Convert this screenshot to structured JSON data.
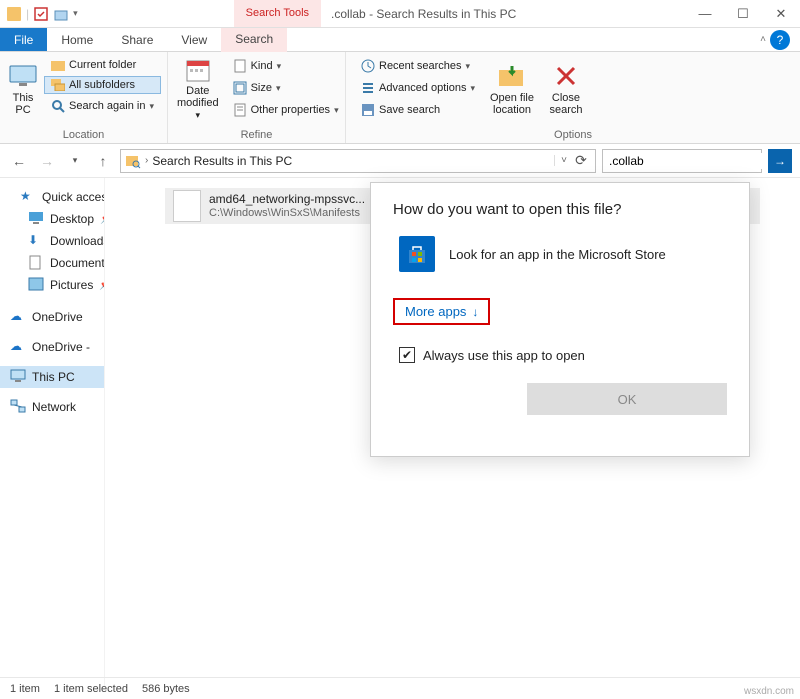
{
  "window": {
    "title": ".collab - Search Results in This PC",
    "search_tools_label": "Search Tools"
  },
  "tabs": {
    "file": "File",
    "home": "Home",
    "share": "Share",
    "view": "View",
    "search": "Search"
  },
  "ribbon": {
    "location": {
      "this_pc": "This PC",
      "current_folder": "Current folder",
      "all_subfolders": "All subfolders",
      "search_again_in": "Search again in",
      "group_label": "Location"
    },
    "refine": {
      "date_modified": "Date modified",
      "kind": "Kind",
      "size": "Size",
      "other_properties": "Other properties",
      "group_label": "Refine"
    },
    "options": {
      "recent_searches": "Recent searches",
      "advanced_options": "Advanced options",
      "save_search": "Save search",
      "open_file_location": "Open file location",
      "close_search": "Close search",
      "group_label": "Options"
    }
  },
  "address": {
    "label": "Search Results in This PC"
  },
  "search": {
    "value": ".collab"
  },
  "sidebar": {
    "quick_access": "Quick access",
    "items": [
      "Desktop",
      "Downloads",
      "Documents",
      "Pictures"
    ],
    "onedrive1": "OneDrive",
    "onedrive2": "OneDrive -",
    "this_pc": "This PC",
    "network": "Network"
  },
  "results": [
    {
      "name": "amd64_networking-mpssvc...",
      "path": "C:\\Windows\\WinSxS\\Manifests"
    }
  ],
  "dialog": {
    "title": "How do you want to open this file?",
    "store": "Look for an app in the Microsoft Store",
    "more_apps": "More apps",
    "always": "Always use this app to open",
    "ok": "OK"
  },
  "status": {
    "items": "1 item",
    "selected": "1 item selected",
    "size": "586 bytes"
  },
  "watermark": "wsxdn.com"
}
